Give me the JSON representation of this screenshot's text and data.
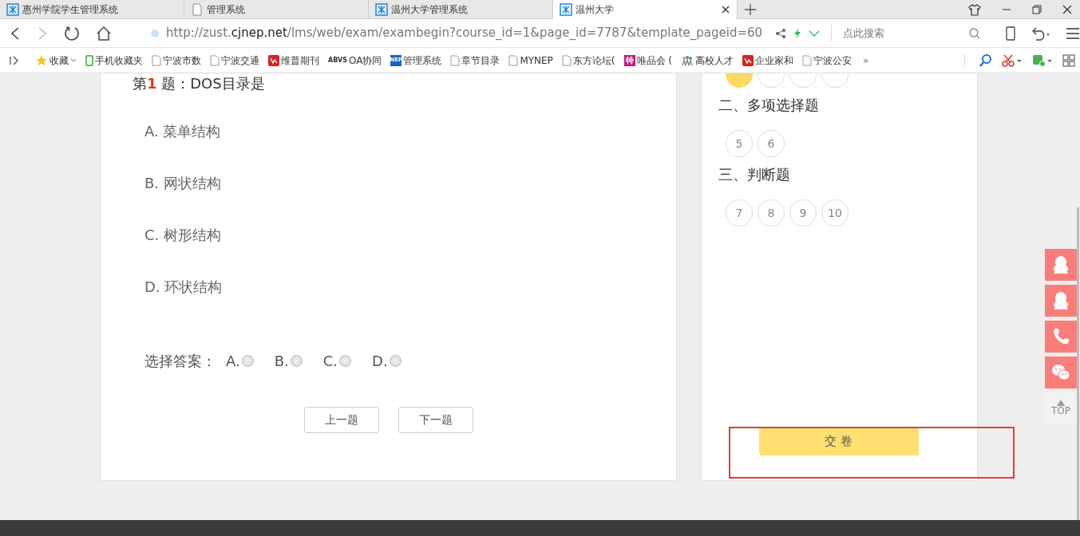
{
  "browser": {
    "tabs": [
      {
        "title": "惠州学院学生管理系统",
        "kind": "logo",
        "selected": false
      },
      {
        "title": "管理系统",
        "kind": "page",
        "selected": false
      },
      {
        "title": "温州大学管理系统",
        "kind": "logo",
        "selected": false
      },
      {
        "title": "温州大学",
        "kind": "logo",
        "selected": true
      }
    ],
    "url": "http://zust.**cjnep.net**/lms/web/exam/exambegin?course_id=1&page_id=7787&template_pageid=60",
    "search_placeholder": "点此搜索",
    "bookmarks": [
      {
        "label": "收藏",
        "kind": "star"
      },
      {
        "label": "手机收藏夹",
        "kind": "phone"
      },
      {
        "label": "宁波市数",
        "kind": "page"
      },
      {
        "label": "宁波交通",
        "kind": "page"
      },
      {
        "label": "维普期刊",
        "kind": "red"
      },
      {
        "label": "OA协同",
        "kind": "text",
        "icon_text": "ABVS"
      },
      {
        "label": "管理系统",
        "kind": "blue",
        "icon_text": "NEP"
      },
      {
        "label": "章节目录",
        "kind": "page"
      },
      {
        "label": "MYNEP",
        "kind": "page"
      },
      {
        "label": "东方论坛(",
        "kind": "page"
      },
      {
        "label": "唯品会 (",
        "kind": "pink",
        "icon_text": "特"
      },
      {
        "label": "高校人才",
        "kind": "people"
      },
      {
        "label": "企业家和",
        "kind": "red"
      },
      {
        "label": "宁波公安",
        "kind": "page"
      }
    ],
    "bookmarks_more": "»"
  },
  "question": {
    "title": "第**1** 题：DOS目录是",
    "options": [
      "A. 菜单结构",
      "B. 网状结构",
      "C. 树形结构",
      "D. 环状结构"
    ],
    "answer_label": "选择答案：",
    "choices": [
      {
        "label": "A.",
        "selected": false
      },
      {
        "label": "B.",
        "selected": false
      },
      {
        "label": "C.",
        "selected": false
      },
      {
        "label": "D.",
        "selected": false
      }
    ],
    "prev": "上一题",
    "next": "下一题"
  },
  "answer_card": {
    "sections": [
      {
        "items": [
          {
            "selected": true
          },
          {
            "selected": false
          },
          {
            "selected": false
          },
          {
            "selected": false
          }
        ]
      },
      {
        "heading": "二、多项选择题",
        "items": [
          {
            "number": "5",
            "selected": false
          },
          {
            "number": "6",
            "selected": false
          }
        ]
      },
      {
        "heading": "三、判断题",
        "items": [
          {
            "number": "7",
            "selected": false
          },
          {
            "number": "8",
            "selected": false
          },
          {
            "number": "9",
            "selected": false
          },
          {
            "number": "10",
            "selected": false
          }
        ]
      }
    ],
    "submit": "交 卷",
    "highlighted": true
  },
  "side_tools": [
    {
      "kind": "qq"
    },
    {
      "kind": "qq"
    },
    {
      "kind": "phone"
    },
    {
      "kind": "wechat"
    }
  ],
  "top_label": "TOP"
}
